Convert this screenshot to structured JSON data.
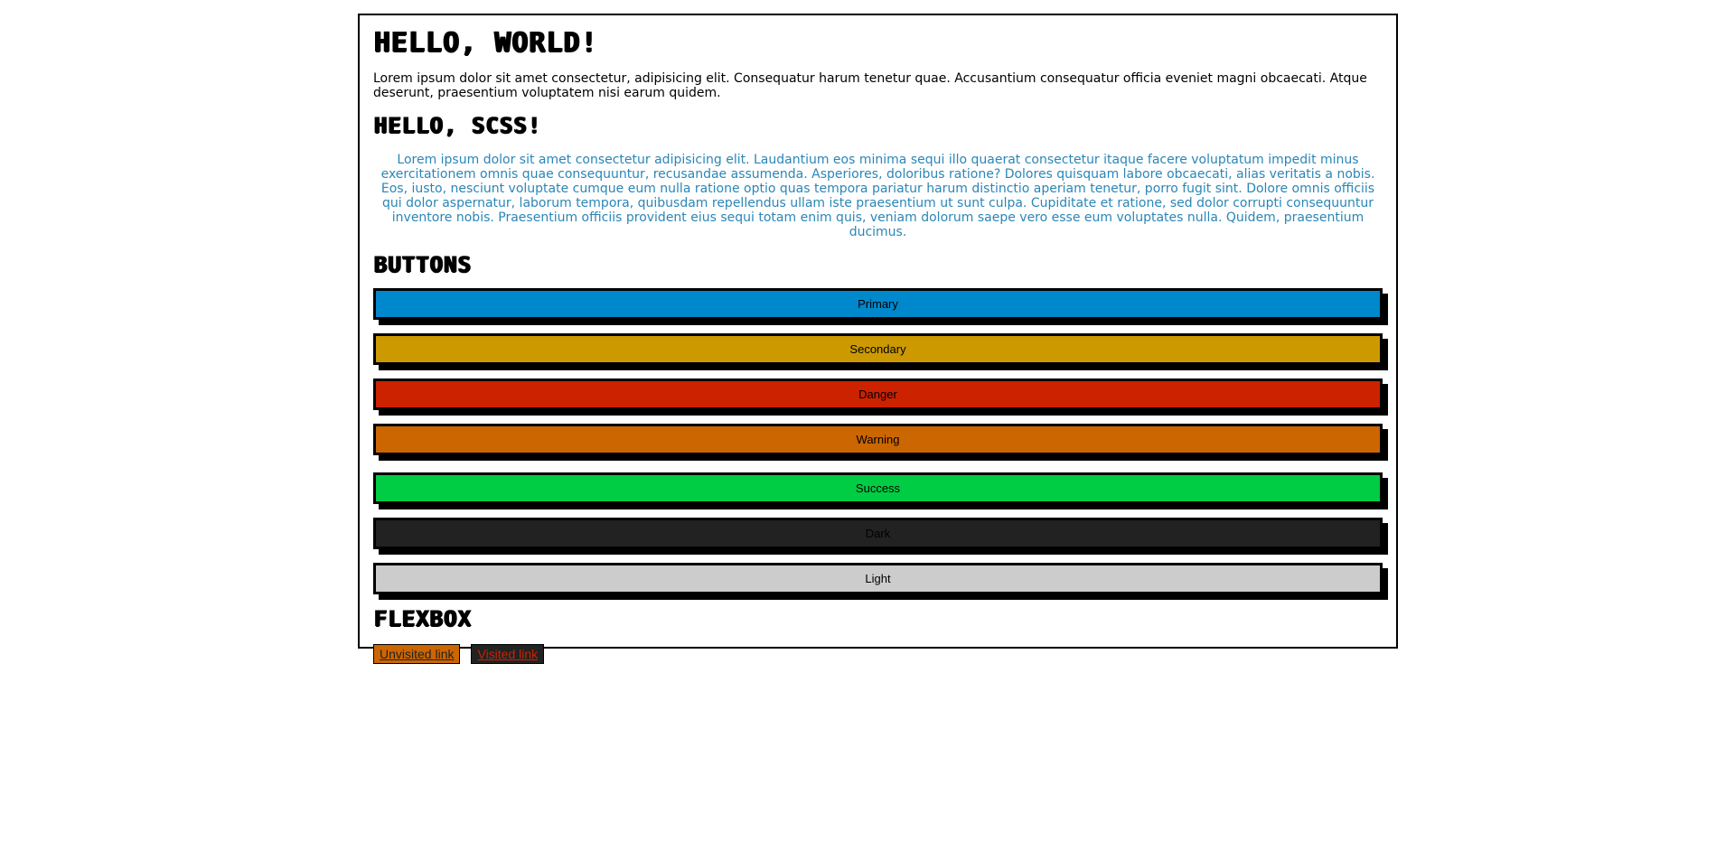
{
  "header": {
    "title": "HELLO, WORLD!",
    "intro": "Lorem ipsum dolor sit amet consectetur, adipisicing elit. Consequatur harum tenetur quae. Accusantium consequatur officia eveniet magni obcaecati. Atque deserunt, praesentium voluptatem nisi earum quidem."
  },
  "scss": {
    "title": "HELLO, SCSS!",
    "text": "Lorem ipsum dolor sit amet consectetur adipisicing elit. Laudantium eos minima sequi illo quaerat consectetur itaque facere voluptatum impedit minus exercitationem omnis quae consequuntur, recusandae assumenda. Asperiores, doloribus ratione? Dolores quisquam labore obcaecati, alias veritatis a nobis. Eos, iusto, nesciunt voluptate cumque eum nulla ratione optio quas tempora pariatur harum distinctio aperiam tenetur, porro fugit sint. Dolore omnis officiis qui dolor aspernatur, laborum tempora, quibusdam repellendus ullam iste praesentium ut sunt culpa. Cupiditate et ratione, sed dolor corrupti consequuntur inventore nobis. Praesentium officiis provident eius sequi totam enim quis, veniam dolorum saepe vero esse eum voluptates nulla. Quidem, praesentium ducimus.",
    "text_color": "#2a86b8"
  },
  "buttons": {
    "title": "BUTTONS",
    "items": [
      {
        "label": "Primary",
        "color": "#0088cc"
      },
      {
        "label": "Secondary",
        "color": "#cc9900"
      },
      {
        "label": "Danger",
        "color": "#cc2200"
      },
      {
        "label": "Warning",
        "color": "#cc6600"
      },
      {
        "label": "Success",
        "color": "#00cc44"
      },
      {
        "label": "Dark",
        "color": "#222222"
      },
      {
        "label": "Light",
        "color": "#cccccc"
      }
    ]
  },
  "flexbox": {
    "title": "FLEXBOX",
    "links": [
      {
        "label": "Unvisited link",
        "bg": "#cc6600",
        "color": "#222222"
      },
      {
        "label": "Visited link",
        "bg": "#222222",
        "color": "#cc2200"
      }
    ]
  }
}
